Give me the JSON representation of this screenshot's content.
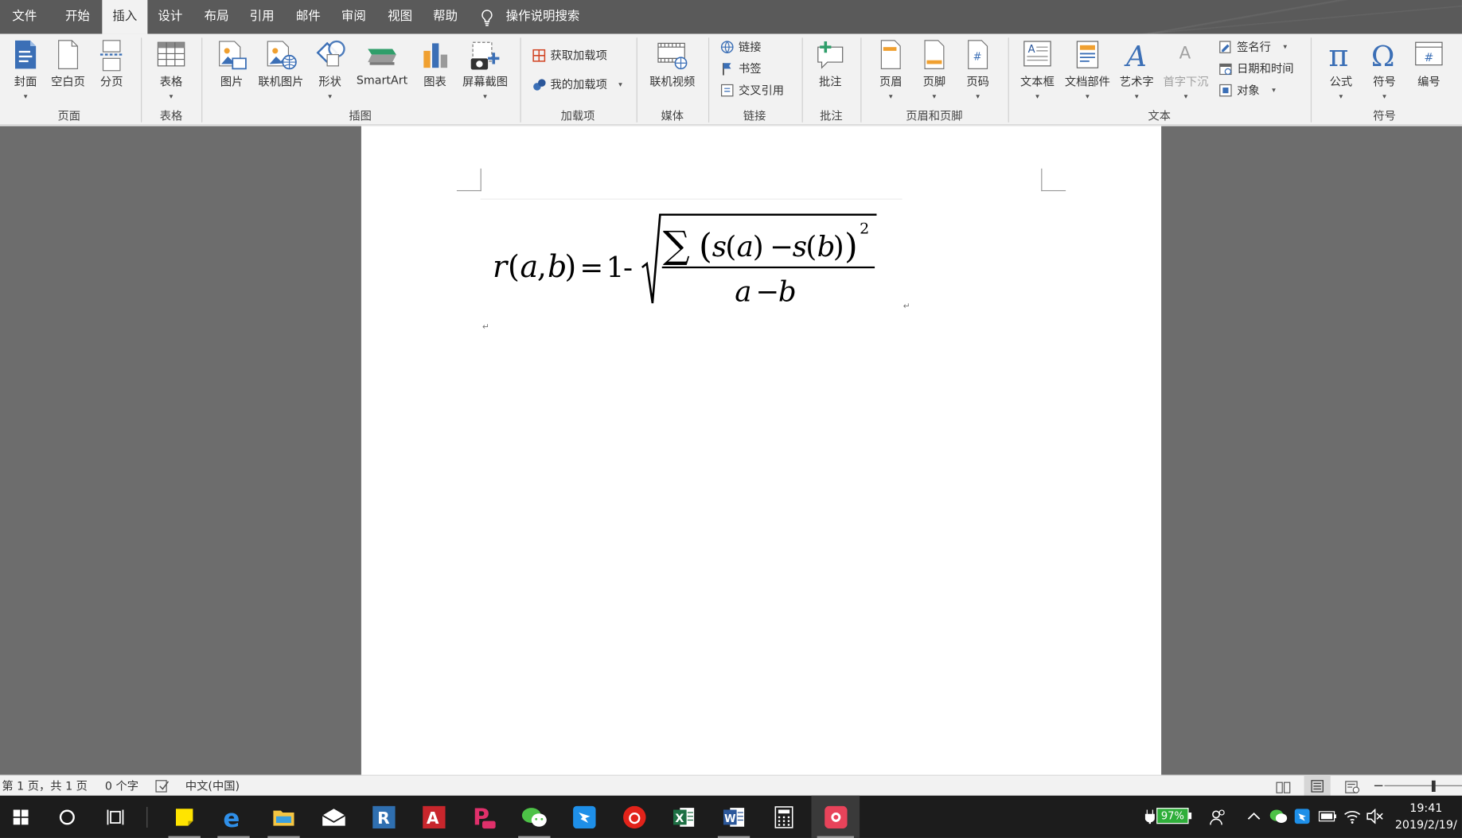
{
  "menu": {
    "tabs": [
      {
        "id": "file",
        "label": "文件"
      },
      {
        "id": "home",
        "label": "开始"
      },
      {
        "id": "insert",
        "label": "插入",
        "active": true
      },
      {
        "id": "design",
        "label": "设计"
      },
      {
        "id": "layout",
        "label": "布局"
      },
      {
        "id": "references",
        "label": "引用"
      },
      {
        "id": "mailings",
        "label": "邮件"
      },
      {
        "id": "review",
        "label": "审阅"
      },
      {
        "id": "view",
        "label": "视图"
      },
      {
        "id": "help",
        "label": "帮助"
      }
    ],
    "search_label": "操作说明搜索"
  },
  "ribbon": {
    "pages": {
      "cover": "封面",
      "blank": "空白页",
      "break": "分页",
      "group": "页面"
    },
    "tables": {
      "table": "表格",
      "group": "表格"
    },
    "illustrations": {
      "picture": "图片",
      "online_picture": "联机图片",
      "shapes": "形状",
      "smartart": "SmartArt",
      "chart": "图表",
      "screenshot": "屏幕截图",
      "group": "插图"
    },
    "addins": {
      "get": "获取加载项",
      "my": "我的加载项",
      "group": "加载项"
    },
    "media": {
      "online_video": "联机视频",
      "group": "媒体"
    },
    "links": {
      "link": "链接",
      "bookmark": "书签",
      "cross_ref": "交叉引用",
      "group": "链接"
    },
    "comments": {
      "comment": "批注",
      "group": "批注"
    },
    "header_footer": {
      "header": "页眉",
      "footer": "页脚",
      "page_number": "页码",
      "group": "页眉和页脚"
    },
    "text": {
      "textbox": "文本框",
      "quick_parts": "文档部件",
      "wordart": "艺术字",
      "drop_cap": "首字下沉",
      "signature": "签名行",
      "datetime": "日期和时间",
      "object": "对象",
      "group": "文本"
    },
    "symbols": {
      "equation": "公式",
      "symbol": "符号",
      "number": "编号",
      "group": "符号"
    }
  },
  "document": {
    "formula": {
      "lhs_r": "r",
      "lp": "(",
      "a1": "a",
      "comma": ",",
      "b1": "b",
      "rp": ")",
      "eq": "=",
      "one": "1",
      "minus": "-",
      "sum": "∑",
      "n_lp": "(",
      "s1": "s",
      "s1_lp": "(",
      "a2": "a",
      "s1_rp": ")",
      "n_minus": "−",
      "s2": "s",
      "s2_lp": "(",
      "b2": "b",
      "s2_rp": ")",
      "n_rp": ")",
      "exp": "2",
      "den_a": "a",
      "den_minus": "−",
      "den_b": "b"
    },
    "para_mark": "↵"
  },
  "status": {
    "page": "第 1 页，共 1 页",
    "words": "0 个字",
    "language": "中文(中国)"
  },
  "taskbar": {
    "battery": "97%",
    "time": "19:41",
    "date": "2019/2/19/"
  },
  "colors": {
    "menubar": "#5a5a5a",
    "ribbon": "#f2f2f2",
    "doc_bg": "#6d6d6d",
    "taskbar": "#1c1c1c",
    "word_blue": "#2b579a"
  }
}
